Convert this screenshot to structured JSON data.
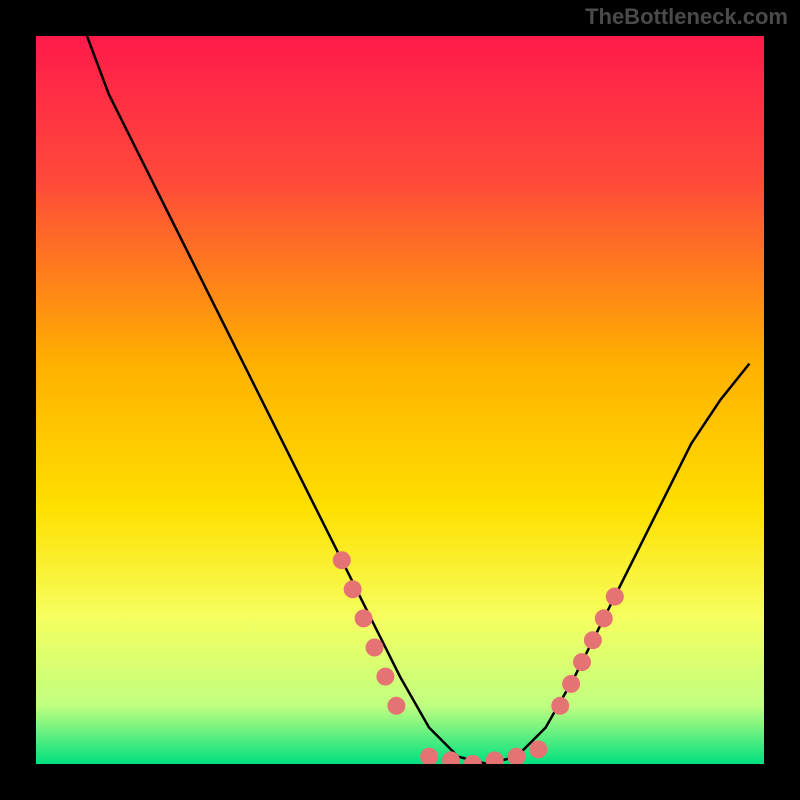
{
  "watermark": "TheBottleneck.com",
  "chart_data": {
    "type": "line",
    "title": "",
    "xlabel": "",
    "ylabel": "",
    "xlim": [
      0,
      100
    ],
    "ylim": [
      0,
      100
    ],
    "background_gradient": {
      "stops": [
        {
          "offset": 0,
          "color": "#ff1a4a"
        },
        {
          "offset": 20,
          "color": "#ff4a3a"
        },
        {
          "offset": 45,
          "color": "#ffb000"
        },
        {
          "offset": 65,
          "color": "#ffe000"
        },
        {
          "offset": 80,
          "color": "#f5ff60"
        },
        {
          "offset": 92,
          "color": "#c0ff80"
        },
        {
          "offset": 100,
          "color": "#00e080"
        }
      ]
    },
    "series": [
      {
        "name": "curve",
        "type": "line",
        "color": "#000000",
        "x": [
          7,
          10,
          14,
          18,
          22,
          26,
          30,
          34,
          38,
          42,
          46,
          50,
          54,
          58,
          62,
          66,
          70,
          74,
          78,
          82,
          86,
          90,
          94,
          98
        ],
        "y": [
          100,
          92,
          84,
          76,
          68,
          60,
          52,
          44,
          36,
          28,
          20,
          12,
          5,
          1,
          0,
          1,
          5,
          12,
          20,
          28,
          36,
          44,
          50,
          55
        ]
      },
      {
        "name": "markers-left",
        "type": "scatter",
        "color": "#e57373",
        "x": [
          42,
          43.5,
          45,
          46.5,
          48,
          49.5
        ],
        "y": [
          28,
          24,
          20,
          16,
          12,
          8
        ]
      },
      {
        "name": "markers-bottom",
        "type": "scatter",
        "color": "#e57373",
        "x": [
          54,
          57,
          60,
          63,
          66,
          69
        ],
        "y": [
          1,
          0.5,
          0,
          0.5,
          1,
          2
        ]
      },
      {
        "name": "markers-right",
        "type": "scatter",
        "color": "#e57373",
        "x": [
          72,
          73.5,
          75,
          76.5,
          78,
          79.5
        ],
        "y": [
          8,
          11,
          14,
          17,
          20,
          23
        ]
      }
    ]
  }
}
